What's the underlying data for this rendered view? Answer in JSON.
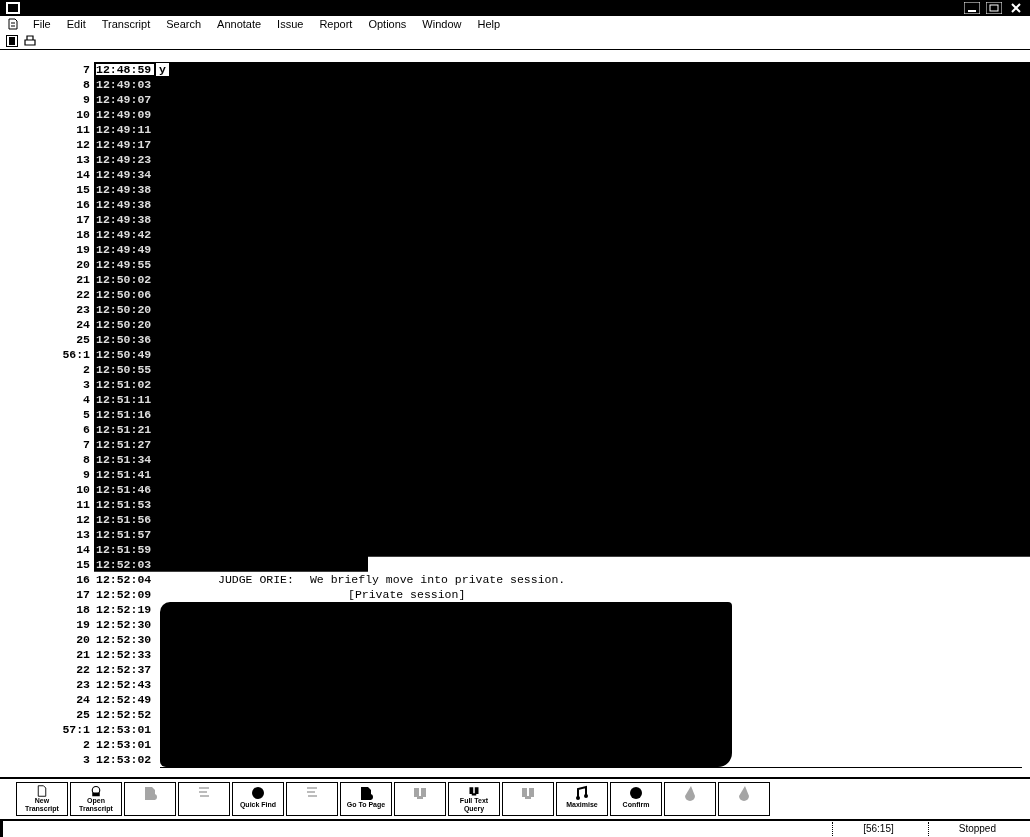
{
  "menu": [
    "File",
    "Edit",
    "Transcript",
    "Search",
    "Annotate",
    "Issue",
    "Report",
    "Options",
    "Window",
    "Help"
  ],
  "lines": [
    {
      "num": "7",
      "time": "12:48:59",
      "kind": "redacted",
      "selected": true,
      "text": "y"
    },
    {
      "num": "8",
      "time": "12:49:03",
      "kind": "redacted",
      "selected": false
    },
    {
      "num": "9",
      "time": "12:49:07",
      "kind": "redacted",
      "selected": false
    },
    {
      "num": "10",
      "time": "12:49:09",
      "kind": "redacted",
      "selected": false
    },
    {
      "num": "11",
      "time": "12:49:11",
      "kind": "redacted",
      "selected": false
    },
    {
      "num": "12",
      "time": "12:49:17",
      "kind": "redacted",
      "selected": false
    },
    {
      "num": "13",
      "time": "12:49:23",
      "kind": "redacted",
      "selected": false
    },
    {
      "num": "14",
      "time": "12:49:34",
      "kind": "redacted",
      "selected": false
    },
    {
      "num": "15",
      "time": "12:49:38",
      "kind": "redacted",
      "selected": false
    },
    {
      "num": "16",
      "time": "12:49:38",
      "kind": "redacted",
      "selected": false
    },
    {
      "num": "17",
      "time": "12:49:38",
      "kind": "redacted",
      "selected": false
    },
    {
      "num": "18",
      "time": "12:49:42",
      "kind": "redacted",
      "selected": false
    },
    {
      "num": "19",
      "time": "12:49:49",
      "kind": "redacted",
      "selected": false
    },
    {
      "num": "20",
      "time": "12:49:55",
      "kind": "redacted",
      "selected": false
    },
    {
      "num": "21",
      "time": "12:50:02",
      "kind": "redacted",
      "selected": false
    },
    {
      "num": "22",
      "time": "12:50:06",
      "kind": "redacted",
      "selected": false
    },
    {
      "num": "23",
      "time": "12:50:20",
      "kind": "redacted",
      "selected": false
    },
    {
      "num": "24",
      "time": "12:50:20",
      "kind": "redacted",
      "selected": false
    },
    {
      "num": "25",
      "time": "12:50:36",
      "kind": "redacted",
      "selected": false
    },
    {
      "num": "56:1",
      "time": "12:50:49",
      "kind": "redacted",
      "selected": false
    },
    {
      "num": "2",
      "time": "12:50:55",
      "kind": "redacted",
      "selected": false
    },
    {
      "num": "3",
      "time": "12:51:02",
      "kind": "redacted",
      "selected": false
    },
    {
      "num": "4",
      "time": "12:51:11",
      "kind": "redacted",
      "selected": false
    },
    {
      "num": "5",
      "time": "12:51:16",
      "kind": "redacted",
      "selected": false
    },
    {
      "num": "6",
      "time": "12:51:21",
      "kind": "redacted",
      "selected": false
    },
    {
      "num": "7",
      "time": "12:51:27",
      "kind": "redacted",
      "selected": false
    },
    {
      "num": "8",
      "time": "12:51:34",
      "kind": "redacted",
      "selected": false
    },
    {
      "num": "9",
      "time": "12:51:41",
      "kind": "redacted",
      "selected": false
    },
    {
      "num": "10",
      "time": "12:51:46",
      "kind": "redacted",
      "selected": false
    },
    {
      "num": "11",
      "time": "12:51:53",
      "kind": "redacted",
      "selected": false
    },
    {
      "num": "12",
      "time": "12:51:56",
      "kind": "redacted",
      "selected": false
    },
    {
      "num": "13",
      "time": "12:51:57",
      "kind": "redacted",
      "selected": false
    },
    {
      "num": "14",
      "time": "12:51:59",
      "kind": "redacted",
      "selected": false
    },
    {
      "num": "15",
      "time": "12:52:03",
      "kind": "partial",
      "selected": false
    },
    {
      "num": "16",
      "time": "12:52:04",
      "kind": "text",
      "selected": false,
      "speaker": "JUDGE ORIE:",
      "text": "We briefly move into private session."
    },
    {
      "num": "17",
      "time": "12:52:09",
      "kind": "note",
      "selected": false,
      "text": "[Private session]"
    },
    {
      "num": "18",
      "time": "12:52:19",
      "kind": "blob",
      "selected": false
    },
    {
      "num": "19",
      "time": "12:52:30",
      "kind": "blob",
      "selected": false
    },
    {
      "num": "20",
      "time": "12:52:30",
      "kind": "blob",
      "selected": false
    },
    {
      "num": "21",
      "time": "12:52:33",
      "kind": "blob",
      "selected": false
    },
    {
      "num": "22",
      "time": "12:52:37",
      "kind": "blob",
      "selected": false
    },
    {
      "num": "23",
      "time": "12:52:43",
      "kind": "blob",
      "selected": false
    },
    {
      "num": "24",
      "time": "12:52:49",
      "kind": "blob",
      "selected": false
    },
    {
      "num": "25",
      "time": "12:52:52",
      "kind": "blob",
      "selected": false
    },
    {
      "num": "57:1",
      "time": "12:53:01",
      "kind": "blob",
      "selected": false
    },
    {
      "num": "2",
      "time": "12:53:01",
      "kind": "blob",
      "selected": false
    },
    {
      "num": "3",
      "time": "12:53:02",
      "kind": "blob",
      "selected": false
    }
  ],
  "toolbar": [
    {
      "label": "New Transcript",
      "kind": "page",
      "disabled": false
    },
    {
      "label": "Open Transcript",
      "kind": "open",
      "disabled": false
    },
    {
      "kind": "doc",
      "disabled": true
    },
    {
      "kind": "abc",
      "disabled": true
    },
    {
      "label": "Quick Find",
      "kind": "dot",
      "disabled": false
    },
    {
      "kind": "abc",
      "disabled": true
    },
    {
      "label": "Go To Page",
      "kind": "doc",
      "disabled": false
    },
    {
      "kind": "book",
      "disabled": true
    },
    {
      "label": "Full Text Query",
      "kind": "book",
      "disabled": false
    },
    {
      "kind": "book",
      "disabled": true
    },
    {
      "label": "Maximise",
      "kind": "notes",
      "disabled": false
    },
    {
      "label": "Confirm",
      "kind": "dot",
      "disabled": false
    },
    {
      "kind": "drop",
      "disabled": true
    },
    {
      "kind": "drop",
      "disabled": true
    }
  ],
  "status_bar": {
    "page": "[56:15]",
    "state": "Stopped"
  }
}
